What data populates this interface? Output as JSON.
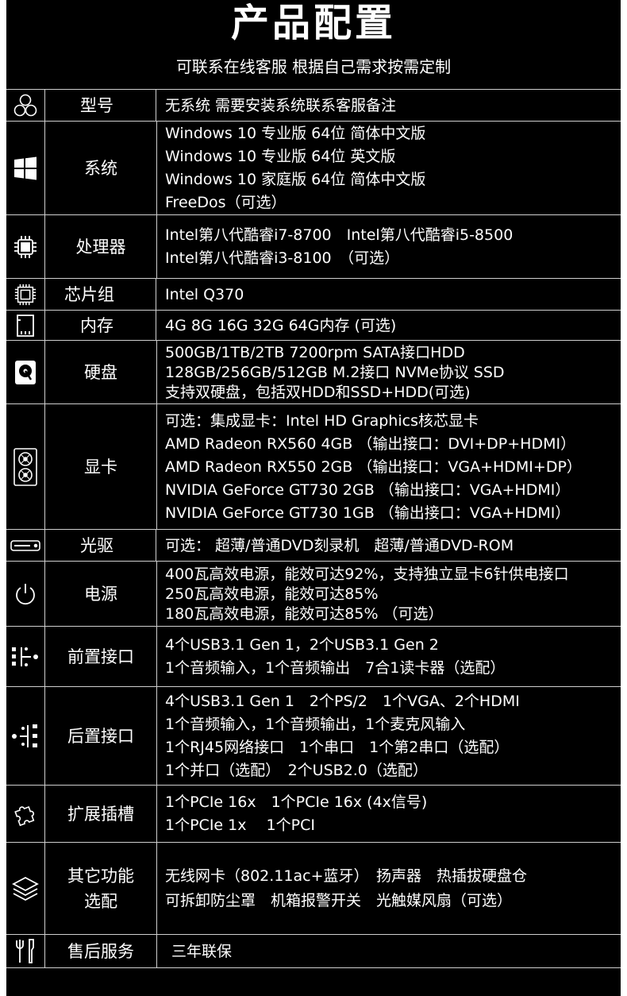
{
  "title": "产品配置",
  "subtitle": "可联系在线客服 根据自己需求按需定制",
  "rows": [
    {
      "icon": "abc-model-icon",
      "label": "型号",
      "values": [
        "无系统 需要安装系统联系客服备注"
      ]
    },
    {
      "icon": "windows-logo-icon",
      "label": "系统",
      "values": [
        "Windows 10 专业版 64位 简体中文版",
        "Windows 10 专业版 64位 英文版",
        "Windows 10 家庭版 64位 简体中文版",
        "FreeDos（可选）"
      ]
    },
    {
      "icon": "cpu-chip-icon",
      "label": "处理器",
      "values": [
        "Intel第八代酷睿i7-8700　Intel第八代酷睿i5-8500",
        "Intel第八代酷睿i3-8100　（可选）"
      ]
    },
    {
      "icon": "chipset-icon",
      "label": "芯片组",
      "values": [
        "Intel Q370"
      ]
    },
    {
      "icon": "memory-card-icon",
      "label": "内存",
      "values": [
        "4G 8G 16G 32G  64G内存 (可选)"
      ]
    },
    {
      "icon": "hard-disk-icon",
      "label": "硬盘",
      "values": [
        "500GB/1TB/2TB 7200rpm SATA接口HDD",
        "128GB/256GB/512GB M.2接口 NVMe协议 SSD",
        "支持双硬盘，包括双HDD和SSD+HDD(可选)"
      ]
    },
    {
      "icon": "graphics-card-icon",
      "label": "显卡",
      "values": [
        "可选：集成显卡：Intel HD Graphics核芯显卡",
        "AMD Radeon RX560 4GB （输出接口：DVI+DP+HDMI）",
        "AMD Radeon RX550 2GB （输出接口：VGA+HDMI+DP）",
        "NVIDIA GeForce GT730 2GB （输出接口：VGA+HDMI）",
        "NVIDIA GeForce GT730 1GB （输出接口：VGA+HDMI）"
      ]
    },
    {
      "icon": "optical-drive-icon",
      "label": "光驱",
      "values": [
        "可选： 超薄/普通DVD刻录机　超薄/普通DVD-ROM"
      ]
    },
    {
      "icon": "power-icon",
      "label": "电源",
      "values": [
        "400瓦高效电源，能效可达92%，支持独立显卡6针供电接口",
        "250瓦高效电源，能效可达85%",
        "180瓦高效电源，能效可达85% （可选）"
      ]
    },
    {
      "icon": "front-ports-icon",
      "label": "前置接口",
      "values": [
        "4个USB3.1 Gen 1，2个USB3.1 Gen 2",
        "1个音频输入，1个音频输出　7合1读卡器（选配）"
      ]
    },
    {
      "icon": "rear-ports-icon",
      "label": "后置接口",
      "values": [
        "4个USB3.1 Gen 1　2个PS/2　1个VGA、2个HDMI",
        "1个音频输入，1个音频输出，1个麦克风输入",
        "1个RJ45网络接口　1个串口　1个第2串口（选配）",
        "1个并口（选配）　2个USB2.0（选配）"
      ]
    },
    {
      "icon": "puzzle-icon",
      "label": "扩展插槽",
      "values": [
        "1个PCIe 16x　1个PCIe 16x (4x信号)",
        "1个PCIe 1x　 1个PCI"
      ]
    },
    {
      "icon": "layers-icon",
      "label": "其它功能\n选配",
      "values": [
        "无线网卡（802.11ac+蓝牙）　扬声器　热插拔硬盘仓",
        "可拆卸防尘罩　机箱报警开关　光触媒风扇（可选）"
      ]
    },
    {
      "icon": "tools-icon",
      "label": "售后服务",
      "values": [
        "三年联保"
      ]
    }
  ]
}
